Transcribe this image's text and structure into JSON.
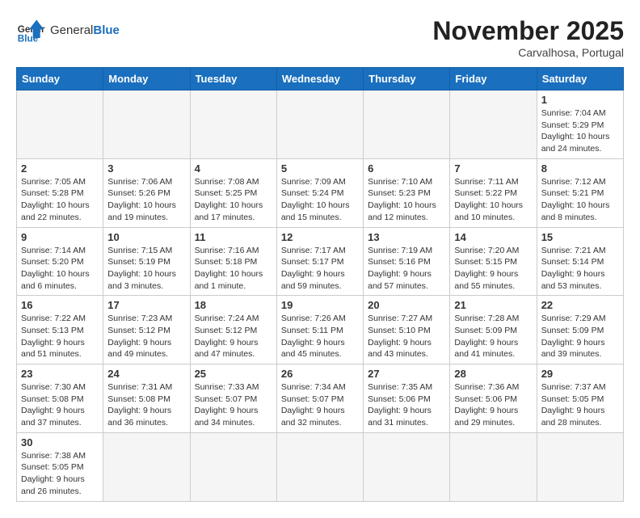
{
  "header": {
    "logo_general": "General",
    "logo_blue": "Blue",
    "month_year": "November 2025",
    "location": "Carvalhosa, Portugal"
  },
  "weekdays": [
    "Sunday",
    "Monday",
    "Tuesday",
    "Wednesday",
    "Thursday",
    "Friday",
    "Saturday"
  ],
  "days": [
    {
      "num": "",
      "info": ""
    },
    {
      "num": "",
      "info": ""
    },
    {
      "num": "",
      "info": ""
    },
    {
      "num": "",
      "info": ""
    },
    {
      "num": "",
      "info": ""
    },
    {
      "num": "",
      "info": ""
    },
    {
      "num": "1",
      "info": "Sunrise: 7:04 AM\nSunset: 5:29 PM\nDaylight: 10 hours\nand 24 minutes."
    },
    {
      "num": "2",
      "info": "Sunrise: 7:05 AM\nSunset: 5:28 PM\nDaylight: 10 hours\nand 22 minutes."
    },
    {
      "num": "3",
      "info": "Sunrise: 7:06 AM\nSunset: 5:26 PM\nDaylight: 10 hours\nand 19 minutes."
    },
    {
      "num": "4",
      "info": "Sunrise: 7:08 AM\nSunset: 5:25 PM\nDaylight: 10 hours\nand 17 minutes."
    },
    {
      "num": "5",
      "info": "Sunrise: 7:09 AM\nSunset: 5:24 PM\nDaylight: 10 hours\nand 15 minutes."
    },
    {
      "num": "6",
      "info": "Sunrise: 7:10 AM\nSunset: 5:23 PM\nDaylight: 10 hours\nand 12 minutes."
    },
    {
      "num": "7",
      "info": "Sunrise: 7:11 AM\nSunset: 5:22 PM\nDaylight: 10 hours\nand 10 minutes."
    },
    {
      "num": "8",
      "info": "Sunrise: 7:12 AM\nSunset: 5:21 PM\nDaylight: 10 hours\nand 8 minutes."
    },
    {
      "num": "9",
      "info": "Sunrise: 7:14 AM\nSunset: 5:20 PM\nDaylight: 10 hours\nand 6 minutes."
    },
    {
      "num": "10",
      "info": "Sunrise: 7:15 AM\nSunset: 5:19 PM\nDaylight: 10 hours\nand 3 minutes."
    },
    {
      "num": "11",
      "info": "Sunrise: 7:16 AM\nSunset: 5:18 PM\nDaylight: 10 hours\nand 1 minute."
    },
    {
      "num": "12",
      "info": "Sunrise: 7:17 AM\nSunset: 5:17 PM\nDaylight: 9 hours\nand 59 minutes."
    },
    {
      "num": "13",
      "info": "Sunrise: 7:19 AM\nSunset: 5:16 PM\nDaylight: 9 hours\nand 57 minutes."
    },
    {
      "num": "14",
      "info": "Sunrise: 7:20 AM\nSunset: 5:15 PM\nDaylight: 9 hours\nand 55 minutes."
    },
    {
      "num": "15",
      "info": "Sunrise: 7:21 AM\nSunset: 5:14 PM\nDaylight: 9 hours\nand 53 minutes."
    },
    {
      "num": "16",
      "info": "Sunrise: 7:22 AM\nSunset: 5:13 PM\nDaylight: 9 hours\nand 51 minutes."
    },
    {
      "num": "17",
      "info": "Sunrise: 7:23 AM\nSunset: 5:12 PM\nDaylight: 9 hours\nand 49 minutes."
    },
    {
      "num": "18",
      "info": "Sunrise: 7:24 AM\nSunset: 5:12 PM\nDaylight: 9 hours\nand 47 minutes."
    },
    {
      "num": "19",
      "info": "Sunrise: 7:26 AM\nSunset: 5:11 PM\nDaylight: 9 hours\nand 45 minutes."
    },
    {
      "num": "20",
      "info": "Sunrise: 7:27 AM\nSunset: 5:10 PM\nDaylight: 9 hours\nand 43 minutes."
    },
    {
      "num": "21",
      "info": "Sunrise: 7:28 AM\nSunset: 5:09 PM\nDaylight: 9 hours\nand 41 minutes."
    },
    {
      "num": "22",
      "info": "Sunrise: 7:29 AM\nSunset: 5:09 PM\nDaylight: 9 hours\nand 39 minutes."
    },
    {
      "num": "23",
      "info": "Sunrise: 7:30 AM\nSunset: 5:08 PM\nDaylight: 9 hours\nand 37 minutes."
    },
    {
      "num": "24",
      "info": "Sunrise: 7:31 AM\nSunset: 5:08 PM\nDaylight: 9 hours\nand 36 minutes."
    },
    {
      "num": "25",
      "info": "Sunrise: 7:33 AM\nSunset: 5:07 PM\nDaylight: 9 hours\nand 34 minutes."
    },
    {
      "num": "26",
      "info": "Sunrise: 7:34 AM\nSunset: 5:07 PM\nDaylight: 9 hours\nand 32 minutes."
    },
    {
      "num": "27",
      "info": "Sunrise: 7:35 AM\nSunset: 5:06 PM\nDaylight: 9 hours\nand 31 minutes."
    },
    {
      "num": "28",
      "info": "Sunrise: 7:36 AM\nSunset: 5:06 PM\nDaylight: 9 hours\nand 29 minutes."
    },
    {
      "num": "29",
      "info": "Sunrise: 7:37 AM\nSunset: 5:05 PM\nDaylight: 9 hours\nand 28 minutes."
    },
    {
      "num": "30",
      "info": "Sunrise: 7:38 AM\nSunset: 5:05 PM\nDaylight: 9 hours\nand 26 minutes."
    },
    {
      "num": "",
      "info": ""
    },
    {
      "num": "",
      "info": ""
    },
    {
      "num": "",
      "info": ""
    },
    {
      "num": "",
      "info": ""
    },
    {
      "num": "",
      "info": ""
    },
    {
      "num": "",
      "info": ""
    }
  ]
}
